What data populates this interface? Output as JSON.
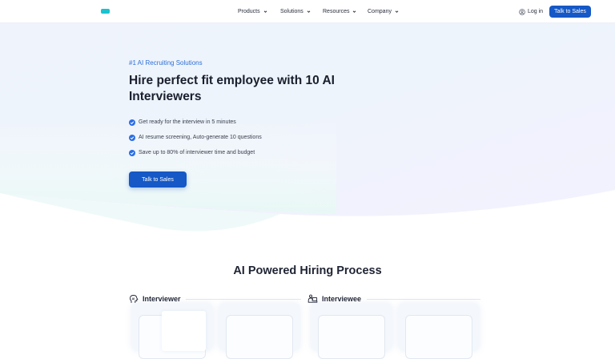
{
  "header": {
    "nav": [
      {
        "label": "Products"
      },
      {
        "label": "Solutions"
      },
      {
        "label": "Resources"
      },
      {
        "label": "Company"
      }
    ],
    "login_label": "Log in",
    "cta_label": "Talk to Sales"
  },
  "hero": {
    "eyebrow": "#1 AI Recruiting Solutions",
    "title": "Hire perfect fit employee with 10 AI Interviewers",
    "bullets": [
      "Get ready for the interview in 5 minutes",
      "AI resume screening, Auto-generate 10 questions",
      "Save up to 80% of interviewer time and budget"
    ],
    "cta_label": "Talk to Sales"
  },
  "section": {
    "title": "AI Powered Hiring Process",
    "roles": [
      {
        "label": "Interviewer",
        "icon": "ai-head-icon"
      },
      {
        "label": "Interviewee",
        "icon": "laptop-user-icon"
      }
    ]
  },
  "colors": {
    "brand": "#1558c6",
    "accent": "#19c3cf",
    "check": "#2b6ee6"
  }
}
